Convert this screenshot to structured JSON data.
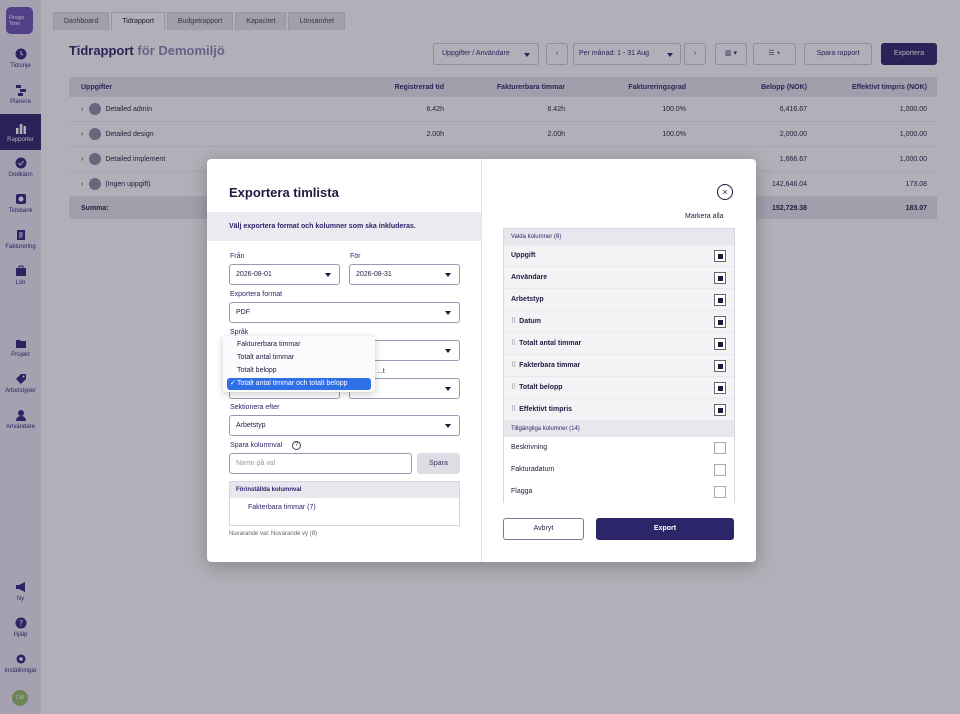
{
  "sidebar": {
    "logo": "Finago Time",
    "items": [
      {
        "label": "Tidsinje",
        "icon": "clock-icon"
      },
      {
        "label": "Planera",
        "icon": "planner-icon"
      },
      {
        "label": "Rapporter",
        "icon": "chart-icon"
      },
      {
        "label": "Godkänn",
        "icon": "check-circle-icon"
      },
      {
        "label": "Tidsbank",
        "icon": "timebank-icon"
      },
      {
        "label": "Fakturering",
        "icon": "invoice-icon"
      },
      {
        "label": "Lön",
        "icon": "salary-icon"
      },
      {
        "label": "Projekt",
        "icon": "folder-icon"
      },
      {
        "label": "Arbetstyper",
        "icon": "tag-icon"
      },
      {
        "label": "Användare",
        "icon": "user-icon"
      },
      {
        "label": "Ny",
        "icon": "megaphone-icon"
      },
      {
        "label": "Hjälp",
        "icon": "help-icon"
      },
      {
        "label": "Inställningar",
        "icon": "gear-icon"
      }
    ],
    "avatar": "DM"
  },
  "tabs": [
    "Dashboard",
    "Tidrapport",
    "Budgetrapport",
    "Kapacitet",
    "Lönsamhet"
  ],
  "header": {
    "title": "Tidrapport",
    "subtitle": "för Demomiljö",
    "group_select": "Uppgifter / Användare",
    "period_select": "Per månad: 1 - 31 Aug",
    "save_report": "Spara rapport",
    "export": "Exportera"
  },
  "table": {
    "columns": [
      "Uppgifter",
      "Registrerad tid",
      "Fakturerbara timmar",
      "Faktureringsgrad",
      "Belopp (NOK)",
      "Effektivt timpris (NOK)"
    ],
    "rows": [
      {
        "task": "Detailed admin",
        "reg": "6.42h",
        "bill": "6.42h",
        "rate": "100.0%",
        "amount": "6,416.67",
        "eff": "1,000.00"
      },
      {
        "task": "Detailed design",
        "reg": "2.00h",
        "bill": "2.00h",
        "rate": "100.0%",
        "amount": "2,000.00",
        "eff": "1,000.00"
      },
      {
        "task": "Detailed implement",
        "reg": "",
        "bill": "",
        "rate": "",
        "amount": "1,666.67",
        "eff": "1,000.00"
      },
      {
        "task": "(Ingen uppgift)",
        "reg": "",
        "bill": "",
        "rate": "",
        "amount": "142,646.04",
        "eff": "173.08"
      }
    ],
    "summary": {
      "label": "Summa:",
      "amount": "152,729.38",
      "eff": "183.07"
    }
  },
  "modal": {
    "title": "Exportera timlista",
    "description": "Välj exportera format och kolumner som ska inkluderas.",
    "from_label": "Från",
    "from_value": "2026-08-01",
    "to_label": "För",
    "to_value": "2026-08-31",
    "format_label": "Exportera format",
    "format_value": "PDF",
    "language_label": "Språk",
    "summary_select_value": "",
    "second_select_partial": "t",
    "second_label_partial": "...t",
    "section_label": "Sektionera efter",
    "section_value": "Arbetstyp",
    "save_cols_label": "Spara kolumnval",
    "save_cols_placeholder": "Namn på val",
    "save_button": "Spara",
    "presets_header": "Förinställda kolumnval",
    "presets": [
      "Fakterbara timmar (7)"
    ],
    "note": "Nuvarande val: Nuvarande vy (8)",
    "dropdown_options": [
      "Fakturerbara timmar",
      "Totalt antal timmar",
      "Totalt belopp",
      "Totalt antal timmar och totalt belopp"
    ],
    "dropdown_selected": "Totalt antal timmar och totalt belopp",
    "mark_all": "Markera alla",
    "selected_header": "Valda kolumner (8)",
    "selected_cols": [
      {
        "label": "Uppgift",
        "drag": false
      },
      {
        "label": "Användare",
        "drag": false
      },
      {
        "label": "Arbetstyp",
        "drag": false
      },
      {
        "label": "Datum",
        "drag": true
      },
      {
        "label": "Totalt antal timmar",
        "drag": true
      },
      {
        "label": "Fakterbara timmar",
        "drag": true
      },
      {
        "label": "Totalt belopp",
        "drag": true
      },
      {
        "label": "Effektivt timpris",
        "drag": true
      }
    ],
    "available_header": "Tillgängliga kolumner (14)",
    "available_cols": [
      "Beskrivning",
      "Fakturadatum",
      "Flagga"
    ],
    "cancel": "Avbryt",
    "export": "Export"
  },
  "colors": {
    "brand": "#2d2569",
    "accent": "#2f6fe8",
    "sidebar_bg": "#eceaf6"
  }
}
